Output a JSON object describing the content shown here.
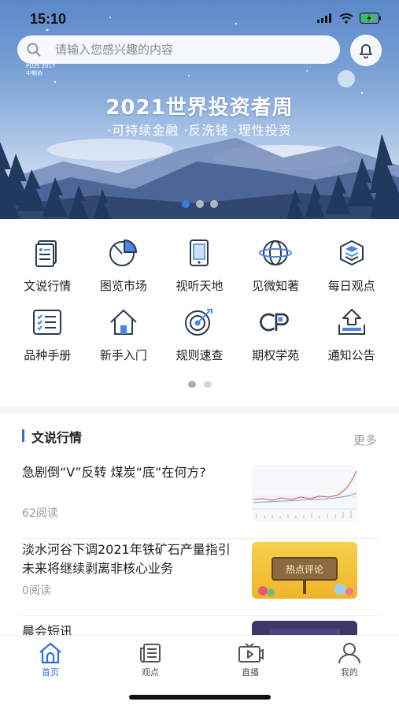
{
  "status": {
    "time": "15:10"
  },
  "search": {
    "placeholder": "请输入您感兴趣的内容"
  },
  "banner": {
    "brand_lines": [
      "PLUS 2017",
      "中期协"
    ],
    "title": "2021世界投资者周",
    "subtitle": "·可持续金融  ·反洗钱  ·理性投资",
    "slides": 3,
    "active_slide": 1
  },
  "grid": {
    "rows": [
      [
        {
          "label": "文说行情",
          "icon": "document-icon"
        },
        {
          "label": "图览市场",
          "icon": "pie-chart-icon"
        },
        {
          "label": "视听天地",
          "icon": "tablet-icon"
        },
        {
          "label": "见微知著",
          "icon": "globe-icon"
        },
        {
          "label": "每日观点",
          "icon": "layers-icon"
        }
      ],
      [
        {
          "label": "品种手册",
          "icon": "checklist-icon"
        },
        {
          "label": "新手入门",
          "icon": "home-icon"
        },
        {
          "label": "规则速查",
          "icon": "target-icon"
        },
        {
          "label": "期权学苑",
          "icon": "cp-icon"
        },
        {
          "label": "通知公告",
          "icon": "upload-tray-icon"
        }
      ]
    ],
    "pages": 2,
    "active_page": 1
  },
  "section": {
    "title": "文说行情",
    "more": "更多"
  },
  "news": [
    {
      "title": "急剧倒“V”反转 煤炭“底”在何方?",
      "reads": "62阅读",
      "thumb": "line-chart"
    },
    {
      "title": "淡水河谷下调2021年铁矿石产量指引 未来将继续剥离非核心业务",
      "reads": "0阅读",
      "thumb": "hot-comment",
      "thumb_text": "热点评论"
    },
    {
      "title": "晨会短讯",
      "reads": "",
      "thumb": "dark"
    }
  ],
  "tabs": [
    {
      "label": "首页",
      "icon": "home-tab-icon",
      "active": true
    },
    {
      "label": "观点",
      "icon": "newspaper-icon",
      "active": false
    },
    {
      "label": "直播",
      "icon": "tv-icon",
      "active": false
    },
    {
      "label": "我的",
      "icon": "user-icon",
      "active": false
    }
  ],
  "colors": {
    "accent": "#2f6fd8",
    "icon_stroke": "#2b3a4e",
    "icon_fill": "#4a86e8"
  }
}
